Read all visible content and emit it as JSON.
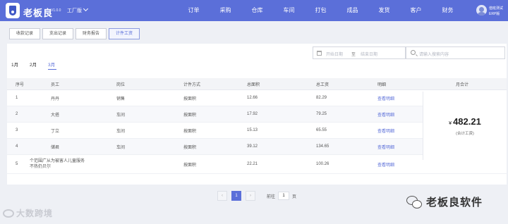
{
  "header": {
    "brand": "老板良",
    "version": "V1.0.0",
    "edition": "工厂版",
    "nav": [
      "订单",
      "采购",
      "仓库",
      "车间",
      "打包",
      "成品",
      "发货",
      "客户",
      "财务"
    ],
    "user_name": "值班测试",
    "user_sub": "ERP版"
  },
  "tabs": [
    {
      "label": "收款记录",
      "active": false
    },
    {
      "label": "支出记录",
      "active": false
    },
    {
      "label": "财务报告",
      "active": false
    },
    {
      "label": "计件工资",
      "active": true
    }
  ],
  "months": [
    {
      "label": "1月",
      "active": false
    },
    {
      "label": "2月",
      "active": false
    },
    {
      "label": "3月",
      "active": true
    }
  ],
  "filters": {
    "start_placeholder": "开始日期",
    "separator": "至",
    "end_placeholder": "结束日期",
    "search_placeholder": "请输入搜索内容"
  },
  "table": {
    "headers": [
      "序号",
      "员工",
      "岗位",
      "计件方式",
      "总面积",
      "总工资",
      "明细",
      "月合计"
    ],
    "rows": [
      {
        "no": "1",
        "staff": "丹丹",
        "post": "销售",
        "mode": "按面积",
        "area": "12.66",
        "wage": "82.29",
        "action": "查看明细"
      },
      {
        "no": "2",
        "staff": "大搭",
        "post": "车间",
        "mode": "按面积",
        "area": "17.92",
        "wage": "79.25",
        "action": "查看明细"
      },
      {
        "no": "3",
        "staff": "丁立",
        "post": "车间",
        "mode": "按面积",
        "area": "15.13",
        "wage": "65.55",
        "action": "查看明细"
      },
      {
        "no": "4",
        "staff": "储君",
        "post": "车间",
        "mode": "按面积",
        "area": "39.12",
        "wage": "134.65",
        "action": "查看明细"
      },
      {
        "no": "5",
        "staff": "个范围广从为被害人儿童服务不热仍贝尔",
        "post": "",
        "mode": "按面积",
        "area": "22.21",
        "wage": "100.26",
        "action": "查看明细"
      }
    ],
    "total_currency": "¥",
    "total_value": "482.21",
    "total_label": "(合计工资)"
  },
  "pagination": {
    "prev": "‹",
    "current": "1",
    "next": "›",
    "goto_label": "前往",
    "goto_value": "1",
    "goto_unit": "页"
  },
  "watermarks": {
    "left": "大数跨境",
    "right": "老板良软件"
  }
}
